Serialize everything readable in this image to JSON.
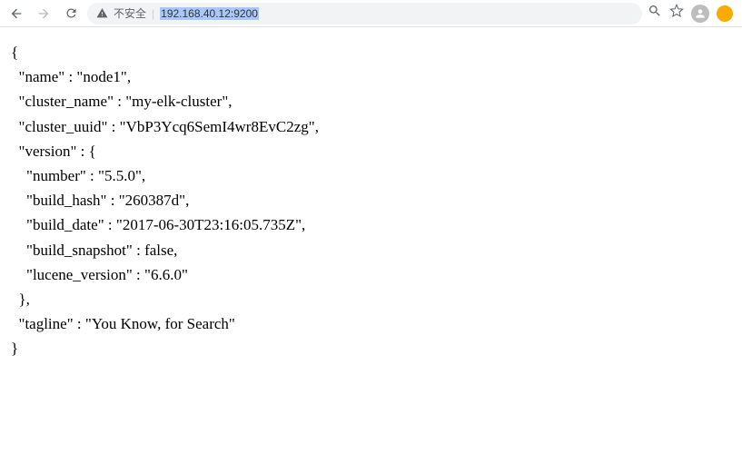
{
  "toolbar": {
    "not_secure_label": "不安全",
    "url": "192.168.40.12:9200"
  },
  "response": {
    "name": "node1",
    "cluster_name": "my-elk-cluster",
    "cluster_uuid": "VbP3Ycq6SemI4wr8EvC2zg",
    "version": {
      "number": "5.5.0",
      "build_hash": "260387d",
      "build_date": "2017-06-30T23:16:05.735Z",
      "build_snapshot": false,
      "lucene_version": "6.6.0"
    },
    "tagline": "You Know, for Search"
  }
}
